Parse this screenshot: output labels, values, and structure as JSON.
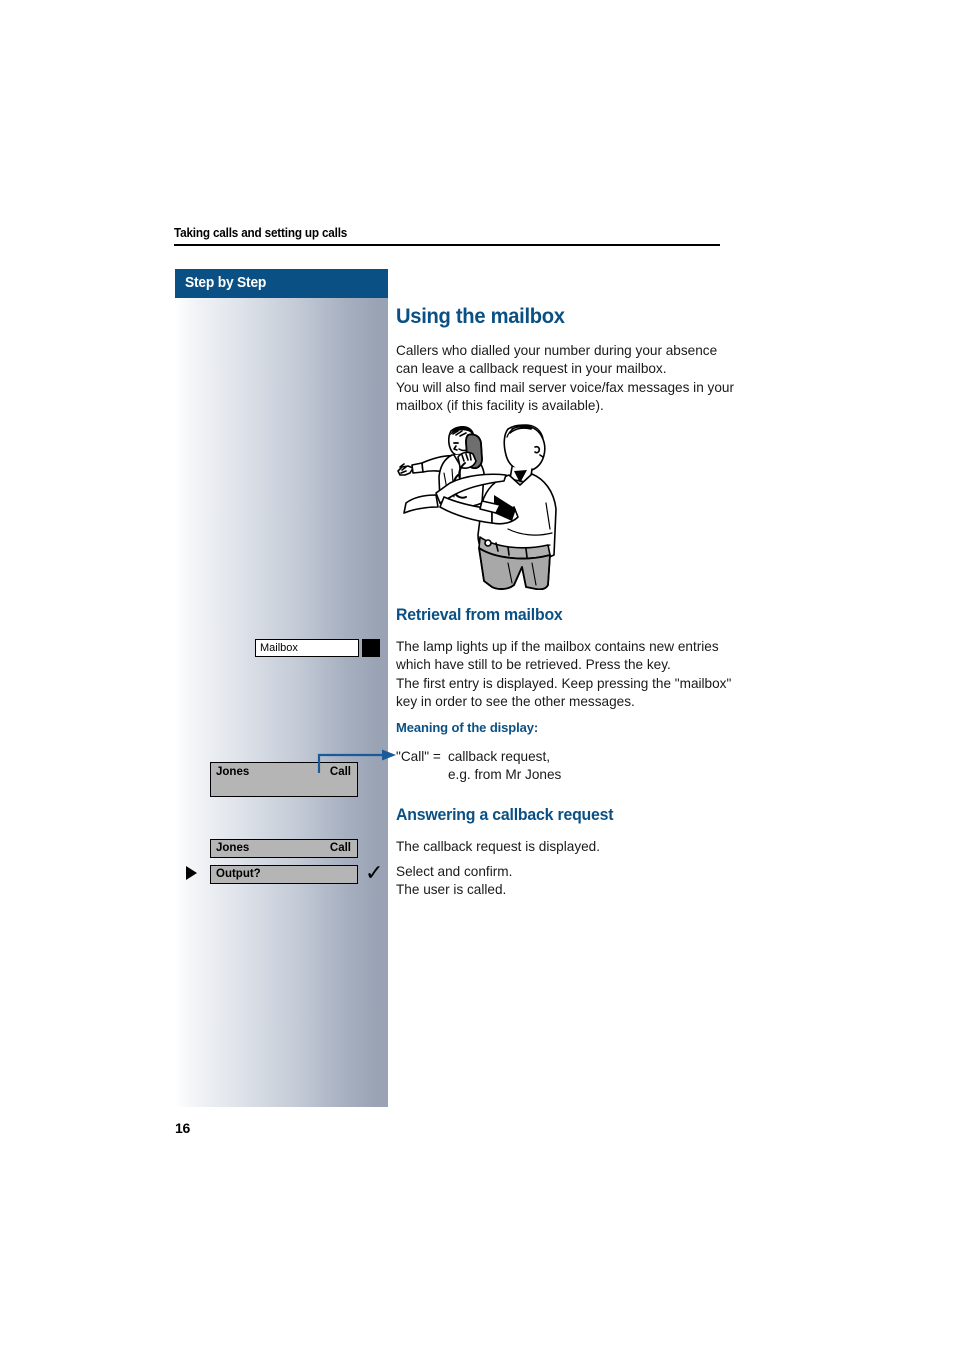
{
  "page": {
    "running_header": "Taking calls and setting up calls",
    "number": "16"
  },
  "sidebar": {
    "header_label": "Step by Step",
    "keys": [
      {
        "label": "Mailbox",
        "lamp": "lamp-indicator"
      }
    ],
    "displays": [
      {
        "left": "Jones",
        "right": "Call"
      },
      {
        "left": "Jones",
        "right": "Call"
      },
      {
        "left": "Output?",
        "right": ""
      }
    ],
    "markers": {
      "select_triangle": "select-triangle",
      "confirm_check": "✓"
    }
  },
  "main": {
    "title": "Using the mailbox",
    "intro": "Callers who dialled your number during your absence\ncan leave a callback request in your mailbox.\nYou will also find mail server voice/fax messages in your\nmailbox (if this facility is available).",
    "illustration_alt": "two-men-handing-telephone-handset",
    "sections": [
      {
        "heading": "Retrieval from mailbox",
        "body": "The lamp lights up if the mailbox contains new entries\nwhich have still to be retrieved. Press the key.\nThe first entry is displayed. Keep pressing the \"mailbox\"\nkey in order to see the other messages.",
        "subheading": "Meaning of the display:",
        "definition": {
          "term": "\"Call\" =",
          "description": "callback request,\ne.g. from Mr Jones"
        }
      },
      {
        "heading": "Answering a callback request",
        "body": "The callback request is displayed.",
        "body2": "Select and confirm.\nThe user is called."
      }
    ]
  },
  "colors": {
    "accent_blue": "#0a5084",
    "display_gray": "#b5b5b5",
    "sidebar_end": "#99a3b4"
  }
}
